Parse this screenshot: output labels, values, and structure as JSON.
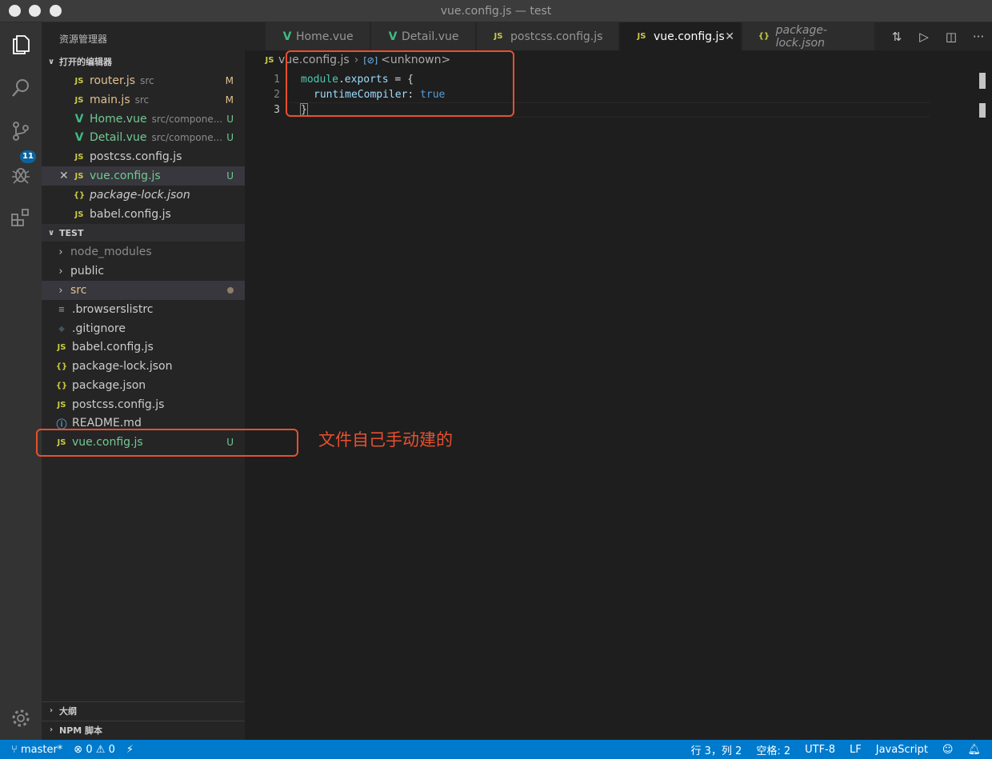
{
  "window": {
    "title": "vue.config.js — test"
  },
  "sidebar": {
    "title": "资源管理器",
    "open_editors_header": "打开的编辑器",
    "open_editors": [
      {
        "icon": "JS",
        "name": "router.js",
        "desc": "src",
        "status": "M"
      },
      {
        "icon": "V",
        "name": "main.js",
        "desc": "src",
        "status": "M"
      },
      {
        "icon": "V",
        "name": "Home.vue",
        "desc": "src/compone...",
        "status": "U"
      },
      {
        "icon": "V",
        "name": "Detail.vue",
        "desc": "src/compone...",
        "status": "U"
      },
      {
        "icon": "JS",
        "name": "postcss.config.js",
        "desc": "",
        "status": ""
      },
      {
        "icon": "JS",
        "name": "vue.config.js",
        "desc": "",
        "status": "U"
      },
      {
        "icon": "{}",
        "name": "package-lock.json",
        "desc": "",
        "status": ""
      },
      {
        "icon": "JS",
        "name": "babel.config.js",
        "desc": "",
        "status": ""
      }
    ],
    "folder_header": "TEST",
    "tree": [
      {
        "name": "node_modules"
      },
      {
        "name": "public"
      },
      {
        "name": "src"
      },
      {
        "icon": "≡",
        "name": ".browserslistrc"
      },
      {
        "icon": "◆",
        "name": ".gitignore"
      },
      {
        "icon": "JS",
        "name": "babel.config.js"
      },
      {
        "icon": "{}",
        "name": "package-lock.json"
      },
      {
        "icon": "{}",
        "name": "package.json"
      },
      {
        "icon": "JS",
        "name": "postcss.config.js"
      },
      {
        "icon": "ⓘ",
        "name": "README.md"
      },
      {
        "icon": "JS",
        "name": "vue.config.js",
        "status": "U"
      }
    ],
    "outline_header": "大纲",
    "npm_header": "NPM 脚本"
  },
  "activity": {
    "scm_badge": "11"
  },
  "tabs": [
    {
      "icon": "V",
      "label": "Home.vue"
    },
    {
      "icon": "V",
      "label": "Detail.vue"
    },
    {
      "icon": "JS",
      "label": "postcss.config.js"
    },
    {
      "icon": "JS",
      "label": "vue.config.js",
      "active": true
    },
    {
      "icon": "{}",
      "label": "package-lock.json"
    }
  ],
  "breadcrumb": {
    "icon": "JS",
    "file": "vue.config.js",
    "symbol_icon": "[⊘]",
    "symbol": "<unknown>"
  },
  "editor": {
    "lines": [
      {
        "num": "1",
        "p1": "module",
        "p2": ".",
        "p3": "exports",
        "p4": " = {"
      },
      {
        "num": "2",
        "p1": "runtimeCompiler",
        "p2": ": ",
        "p3": "true"
      },
      {
        "num": "3",
        "p1": "}"
      }
    ]
  },
  "annotation": {
    "text": "文件自己手动建的"
  },
  "statusbar": {
    "branch": "master*",
    "errors": "0",
    "warnings": "0",
    "position": "行 3，列 2",
    "spaces": "空格: 2",
    "encoding": "UTF-8",
    "eol": "LF",
    "language": "JavaScript"
  },
  "colors": {
    "accent": "#007acc",
    "annotation": "#e8502e",
    "untracked": "#73c991",
    "modified": "#e2c08d"
  }
}
